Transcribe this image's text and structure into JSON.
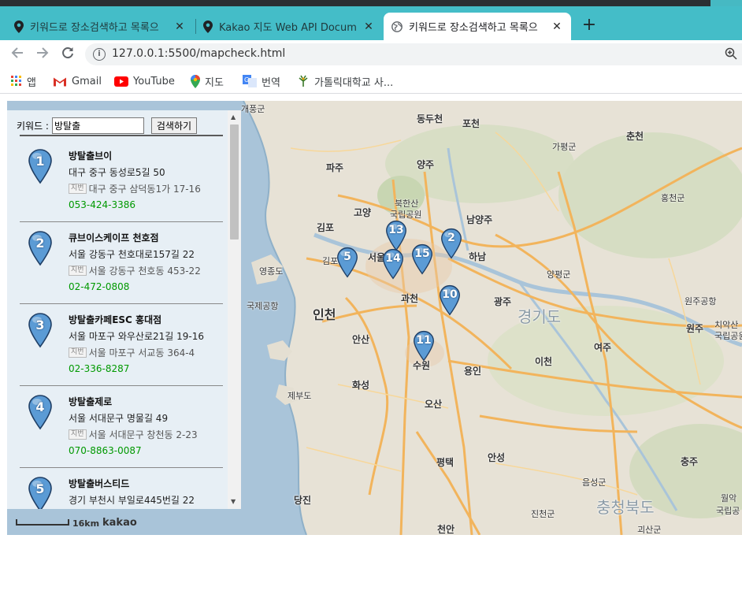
{
  "browser": {
    "tabs": [
      {
        "title": "키워드로 장소검색하고 목록으",
        "active": false,
        "icon": "location-pin-icon"
      },
      {
        "title": "Kakao 지도 Web API Docum",
        "active": false,
        "icon": "location-pin-icon"
      },
      {
        "title": "키워드로 장소검색하고 목록으",
        "active": true,
        "icon": "globe-icon"
      }
    ],
    "close_glyph": "✕",
    "new_tab_glyph": "+",
    "url": "127.0.0.1:5500/mapcheck.html",
    "bookmarks": [
      {
        "label": "앱",
        "icon": "apps-grid-icon"
      },
      {
        "label": "Gmail",
        "icon": "gmail-icon"
      },
      {
        "label": "YouTube",
        "icon": "youtube-icon"
      },
      {
        "label": "지도",
        "icon": "maps-pin-icon"
      },
      {
        "label": "번역",
        "icon": "translate-icon"
      },
      {
        "label": "가톨릭대학교 사...",
        "icon": "university-logo-icon"
      }
    ]
  },
  "search": {
    "label": "키워드 :",
    "value": "방탈출",
    "button": "검색하기"
  },
  "places": [
    {
      "num": "1",
      "name": "방탈출브이",
      "road": "대구 중구 동성로5길 50",
      "jibun_badge": "지번",
      "jibun": "대구 중구 삼덕동1가 17-16",
      "tel": "053-424-3386"
    },
    {
      "num": "2",
      "name": "큐브이스케이프 천호점",
      "road": "서울 강동구 천호대로157길 22",
      "jibun_badge": "지번",
      "jibun": "서울 강동구 천호동 453-22",
      "tel": "02-472-0808"
    },
    {
      "num": "3",
      "name": "방탈출카페ESC 홍대점",
      "road": "서울 마포구 와우산로21길 19-16",
      "jibun_badge": "지번",
      "jibun": "서울 마포구 서교동 364-4",
      "tel": "02-336-8287"
    },
    {
      "num": "4",
      "name": "방탈출제로",
      "road": "서울 서대문구 명물길 49",
      "jibun_badge": "지번",
      "jibun": "서울 서대문구 창천동 2-23",
      "tel": "070-8863-0087"
    },
    {
      "num": "5",
      "name": "방탈출버스티드",
      "road": "경기 부천시 부일로445번길 22",
      "jibun_badge": "",
      "jibun": "",
      "tel": ""
    }
  ],
  "map": {
    "scale_distance": "16km",
    "logo": "kakao",
    "marker_color": "#5b9bd5",
    "labels": [
      {
        "text": "동두천"
      },
      {
        "text": "포천"
      },
      {
        "text": "가평군"
      },
      {
        "text": "춘천"
      },
      {
        "text": "파주"
      },
      {
        "text": "양주"
      },
      {
        "text": "홍천군"
      },
      {
        "text": "고양"
      },
      {
        "text": "북한산"
      },
      {
        "text": "국립공원"
      },
      {
        "text": "남양주"
      },
      {
        "text": "김포"
      },
      {
        "text": "하남"
      },
      {
        "text": "영종도"
      },
      {
        "text": "양평군"
      },
      {
        "text": "과천"
      },
      {
        "text": "광주"
      },
      {
        "text": "경기도"
      },
      {
        "text": "원주공항"
      },
      {
        "text": "인천"
      },
      {
        "text": "국제공항"
      },
      {
        "text": "안산"
      },
      {
        "text": "여주"
      },
      {
        "text": "원주"
      },
      {
        "text": "치악산"
      },
      {
        "text": "국립공원"
      },
      {
        "text": "수원"
      },
      {
        "text": "이천"
      },
      {
        "text": "용인"
      },
      {
        "text": "화성"
      },
      {
        "text": "제부도"
      },
      {
        "text": "오산"
      },
      {
        "text": "충주"
      },
      {
        "text": "평택"
      },
      {
        "text": "안성"
      },
      {
        "text": "음성군"
      },
      {
        "text": "충청북도"
      },
      {
        "text": "당진"
      },
      {
        "text": "진천군"
      },
      {
        "text": "천안"
      },
      {
        "text": "괴산군"
      },
      {
        "text": "월악"
      },
      {
        "text": "국립공"
      },
      {
        "text": "개풍군"
      },
      {
        "text": "김포공항"
      },
      {
        "text": "서울"
      }
    ],
    "pins": [
      "13",
      "5",
      "14",
      "15",
      "2",
      "10",
      "11"
    ]
  }
}
